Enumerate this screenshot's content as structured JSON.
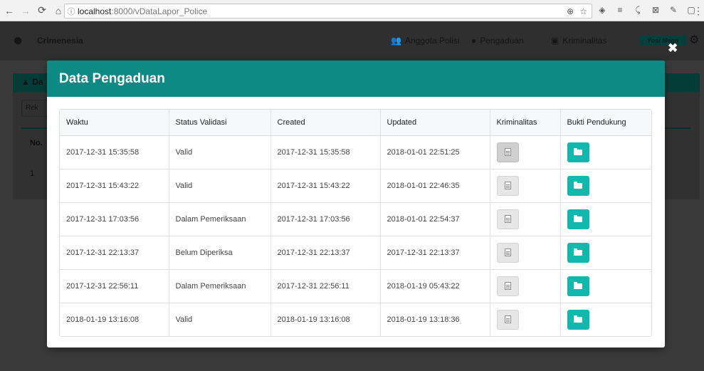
{
  "browser": {
    "url_host": "localhost",
    "url_rest": ":8000/vDataLapor_Police",
    "back_icon": "←",
    "forward_icon": "→",
    "reload_icon": "⟳",
    "home_icon": "⌂"
  },
  "app": {
    "brand": "Crimenesia",
    "nav": [
      {
        "icon": "users-icon",
        "label": "Anggota Polisi"
      },
      {
        "icon": "comment-icon",
        "label": "Pengaduan"
      },
      {
        "icon": "lock-icon",
        "label": "Kriminalitas"
      }
    ],
    "user_badge": "Yosi Mega",
    "panel_label": "Da",
    "search_placeholder": "Rek",
    "col_no": "No.",
    "row_no": "1"
  },
  "modal": {
    "title": "Data Pengaduan",
    "close_label": "✖",
    "columns": [
      "Waktu",
      "Status Validasi",
      "Created",
      "Updated",
      "Kriminalitas",
      "Bukti Pendukung"
    ],
    "rows": [
      {
        "waktu": "2017-12-31 15:35:58",
        "status": "Valid",
        "created": "2017-12-31 15:35:58",
        "updated": "2018-01-01 22:51:25"
      },
      {
        "waktu": "2017-12-31 15:43:22",
        "status": "Valid",
        "created": "2017-12-31 15:43:22",
        "updated": "2018-01-01 22:46:35"
      },
      {
        "waktu": "2017-12-31 17:03:56",
        "status": "Dalam Pemeriksaan",
        "created": "2017-12-31 17:03:56",
        "updated": "2018-01-01 22:54:37"
      },
      {
        "waktu": "2017-12-31 22:13:37",
        "status": "Belum Diperiksa",
        "created": "2017-12-31 22:13:37",
        "updated": "2017-12-31 22:13:37"
      },
      {
        "waktu": "2017-12-31 22:56:11",
        "status": "Dalam Pemeriksaan",
        "created": "2017-12-31 22:56:11",
        "updated": "2018-01-19 05:43:22"
      },
      {
        "waktu": "2018-01-19 13:16:08",
        "status": "Valid",
        "created": "2018-01-19 13:16:08",
        "updated": "2018-01-19 13:18:36"
      }
    ]
  },
  "colors": {
    "modal_header": "#0e8a84",
    "folder_button": "#10b8ad"
  }
}
